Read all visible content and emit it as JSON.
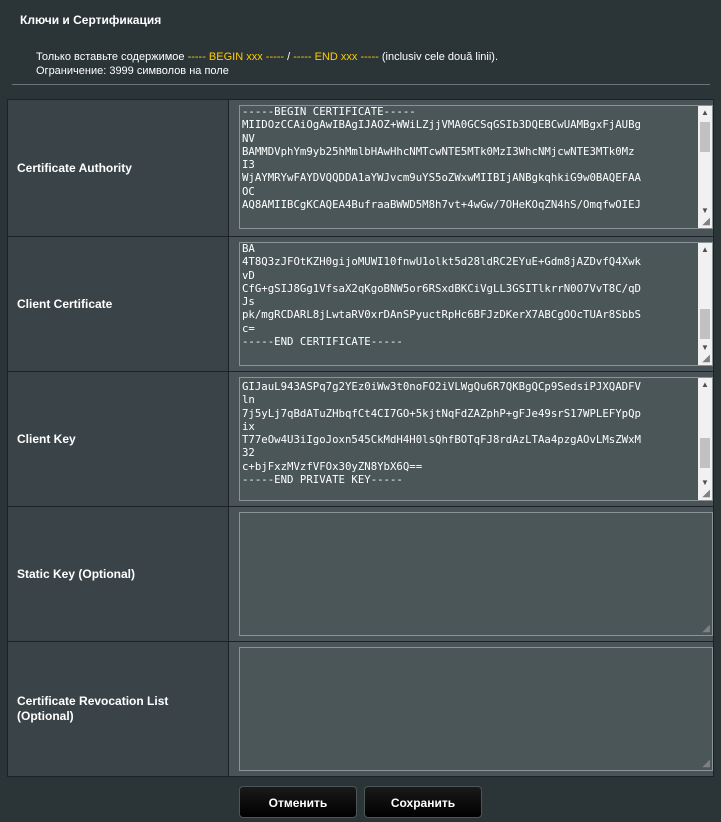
{
  "header": {
    "title": "Ключи и Сертификация",
    "note_prefix": "Только вставьте содержимое ",
    "begin_marker": "----- BEGIN xxx -----",
    "slash": " / ",
    "end_marker": "----- END xxx -----",
    "note_suffix": " (inclusiv cele două linii).",
    "limit_text": "Ограничение: 3999 символов на поле"
  },
  "fields": {
    "ca": {
      "label": "Certificate Authority",
      "value": "-----BEGIN CERTIFICATE-----\nMIIDOzCCAiOgAwIBAgIJAOZ+WWiLZjjVMA0GCSqGSIb3DQEBCwUAMBgxFjAUBg\nNV\nBAMMDVphYm9yb25hMmlbHAwHhcNMTcwNTE5MTk0MzI3WhcNMjcwNTE3MTk0Mz\nI3\nWjAYMRYwFAYDVQQDDA1aYWJvcm9uYS5oZWxwMIIBIjANBgkqhkiG9w0BAQEFAA\nOC\nAQ8AMIIBCgKCAQEA4BufraaBWWD5M8h7vt+4wGw/7OHeKOqZN4hS/OmqfwOIEJ"
    },
    "cert": {
      "label": "Client Certificate",
      "value": "BA\n4T8Q3zJFOtKZH0gijoMUWI10fnwU1olkt5d28ldRC2EYuE+Gdm8jAZDvfQ4Xwk\nvD\nCfG+gSIJ8Gg1VfsaX2qKgoBNW5or6RSxdBKCiVgLL3GSITlkrrN0O7VvT8C/qD\nJs\npk/mgRCDARL8jLwtaRV0xrDAnSPyuctRpHc6BFJzDKerX7ABCgOOcTUAr8SbbS\nc=\n-----END CERTIFICATE-----"
    },
    "key": {
      "label": "Client Key",
      "value": "GIJauL943ASPq7g2YEz0iWw3t0noFO2iVLWgQu6R7QKBgQCp9SedsiPJXQADFV\nln\n7j5yLj7qBdATuZHbqfCt4CI7GO+5kjtNqFdZAZphP+gFJe49srS17WPLEFYpQp\nix\nT77eOw4U3iIgoJoxn545CkMdH4H0lsQhfBOTqFJ8rdAzLTAa4pzgAOvLMsZWxM\n32\nc+bjFxzMVzfVFOx30yZN8YbX6Q==\n-----END PRIVATE KEY-----"
    },
    "static_key": {
      "label": "Static Key (Optional)",
      "value": ""
    },
    "crl": {
      "label": "Certificate Revocation List (Optional)",
      "value": ""
    }
  },
  "buttons": {
    "cancel": "Отменить",
    "save": "Сохранить"
  },
  "colors": {
    "background": "#2b3437",
    "label_cell": "#3a4448",
    "value_cell": "#4a5458",
    "highlight": "#ffcc00"
  }
}
